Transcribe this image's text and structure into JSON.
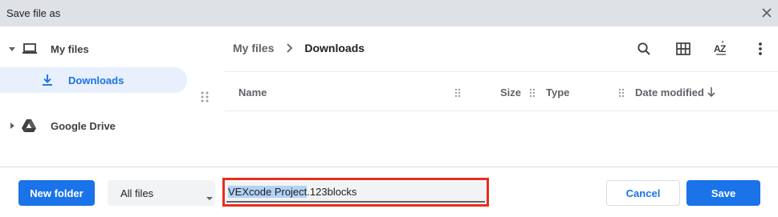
{
  "dialog": {
    "title": "Save file as"
  },
  "sidebar": {
    "items": [
      {
        "label": "My files",
        "icon": "laptop-icon",
        "expanded": true
      },
      {
        "label": "Downloads",
        "icon": "download-icon",
        "selected": true
      },
      {
        "label": "Google Drive",
        "icon": "drive-icon",
        "expanded": false
      }
    ]
  },
  "breadcrumb": {
    "root": "My files",
    "current": "Downloads"
  },
  "toolbar": {
    "icons": [
      "search-icon",
      "grid-view-icon",
      "sort-az-icon",
      "more-vert-icon"
    ]
  },
  "table": {
    "columns": [
      "Name",
      "Size",
      "Type",
      "Date modified"
    ],
    "sort_column": "Date modified",
    "sort_direction": "descending"
  },
  "footer": {
    "new_folder_label": "New folder",
    "file_type_selected": "All files",
    "filename_selected_part": "VEXcode Project",
    "filename_rest": ".123blocks",
    "cancel_label": "Cancel",
    "save_label": "Save"
  },
  "colors": {
    "accent": "#1a73e8",
    "selected_bg": "#e8f0fe",
    "highlight_border": "#ea2c1a",
    "titlebar_bg": "#dee1e6"
  }
}
